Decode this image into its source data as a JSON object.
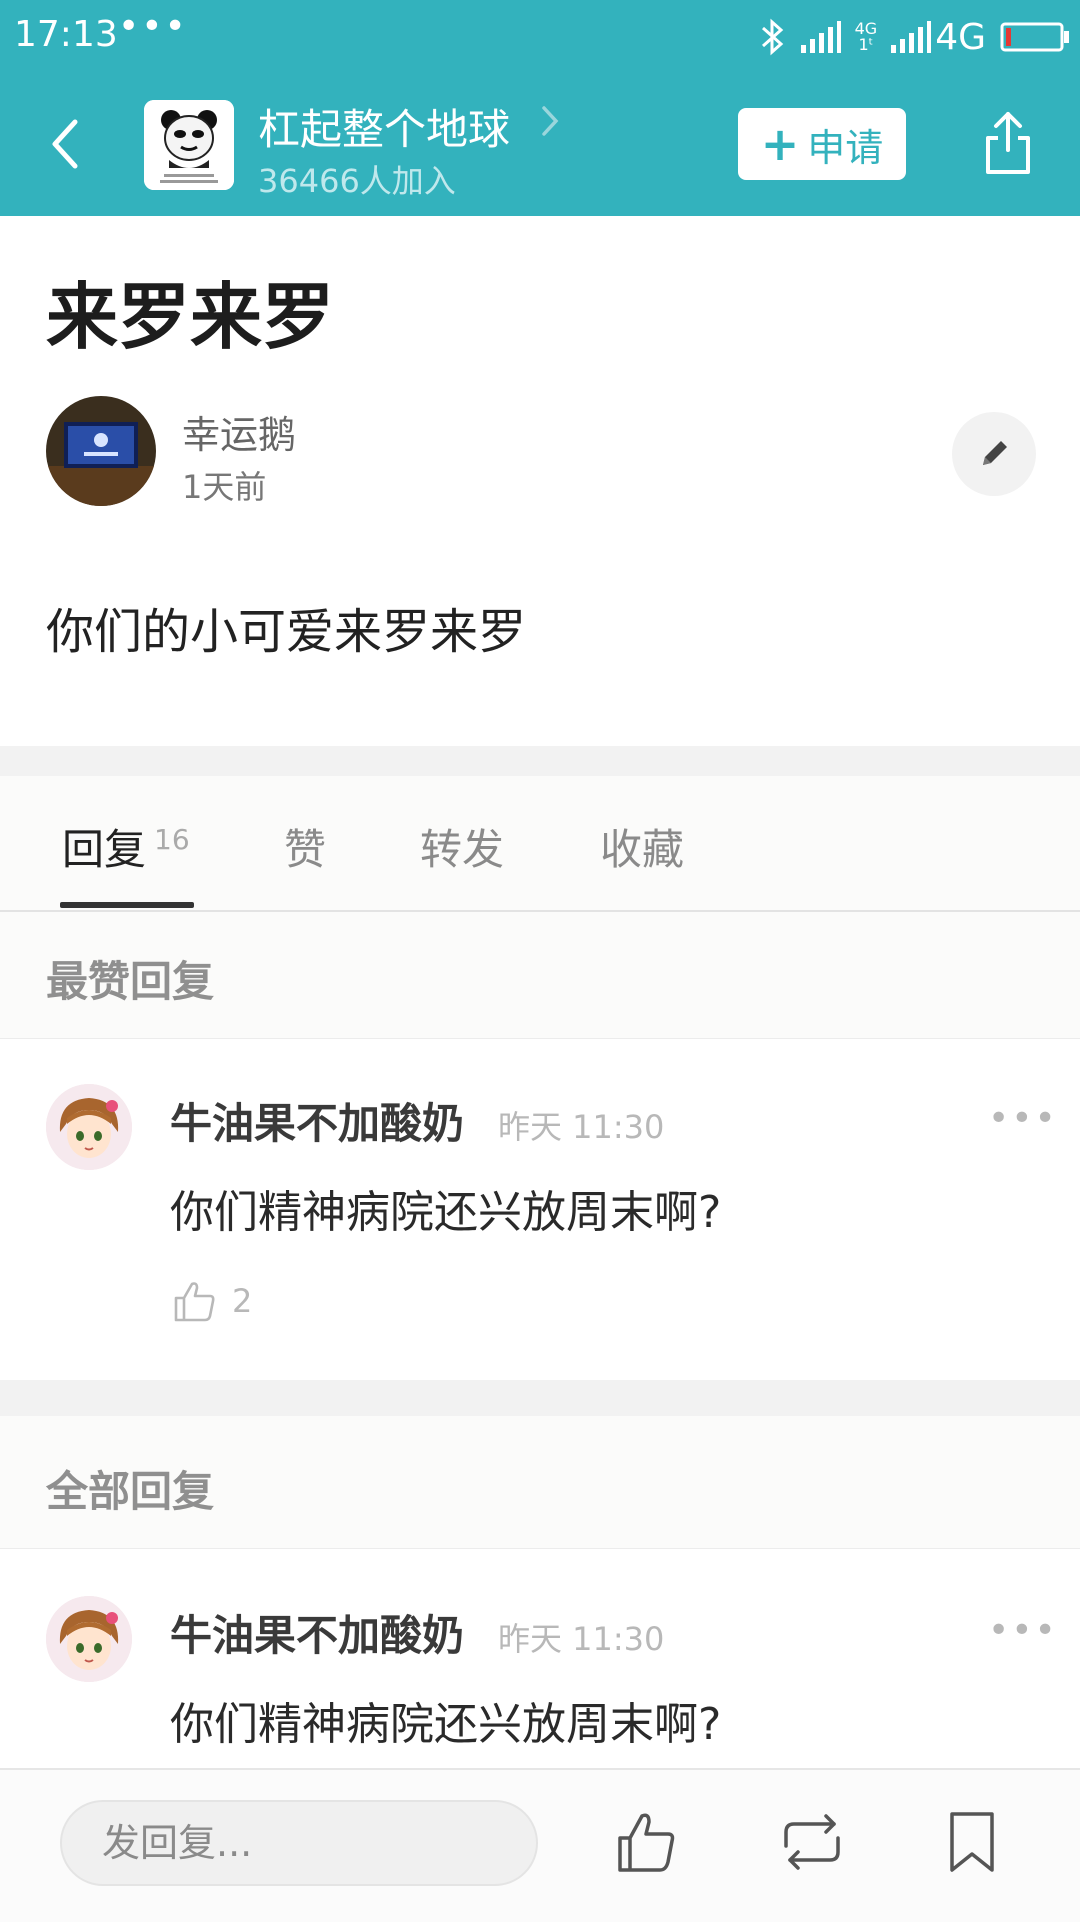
{
  "status_bar": {
    "time": "17:13",
    "dots": "•••",
    "network_small": "4G",
    "network_small_sub": "1ᵗ",
    "network": "4G"
  },
  "group": {
    "name": "杠起整个地球",
    "members": "36466人加入",
    "apply_label": "申请",
    "apply_plus": "+"
  },
  "post": {
    "title": "来罗来罗",
    "author": "幸运鹅",
    "time": "1天前",
    "body": "你们的小可爱来罗来罗"
  },
  "tabs": {
    "reply": "回复",
    "reply_count": "16",
    "like": "赞",
    "forward": "转发",
    "favorite": "收藏"
  },
  "sections": {
    "top": "最赞回复",
    "all": "全部回复"
  },
  "top_comment": {
    "name": "牛油果不加酸奶",
    "time": "昨天 11:30",
    "more": "•••",
    "text": "你们精神病院还兴放周末啊?",
    "likes": "2"
  },
  "all_comment": {
    "name": "牛油果不加酸奶",
    "time": "昨天 11:30",
    "more": "•••",
    "text": "你们精神病院还兴放周末啊?"
  },
  "bottom_bar": {
    "reply_placeholder": "发回复..."
  },
  "colors": {
    "header": "#33b2bd",
    "battery_low": "#e53935"
  },
  "icons": {
    "back": "chevron-left-icon",
    "share": "share-icon",
    "edit": "pencil-icon",
    "like": "thumb-up-icon",
    "forward": "repost-icon",
    "bookmark": "bookmark-icon"
  }
}
